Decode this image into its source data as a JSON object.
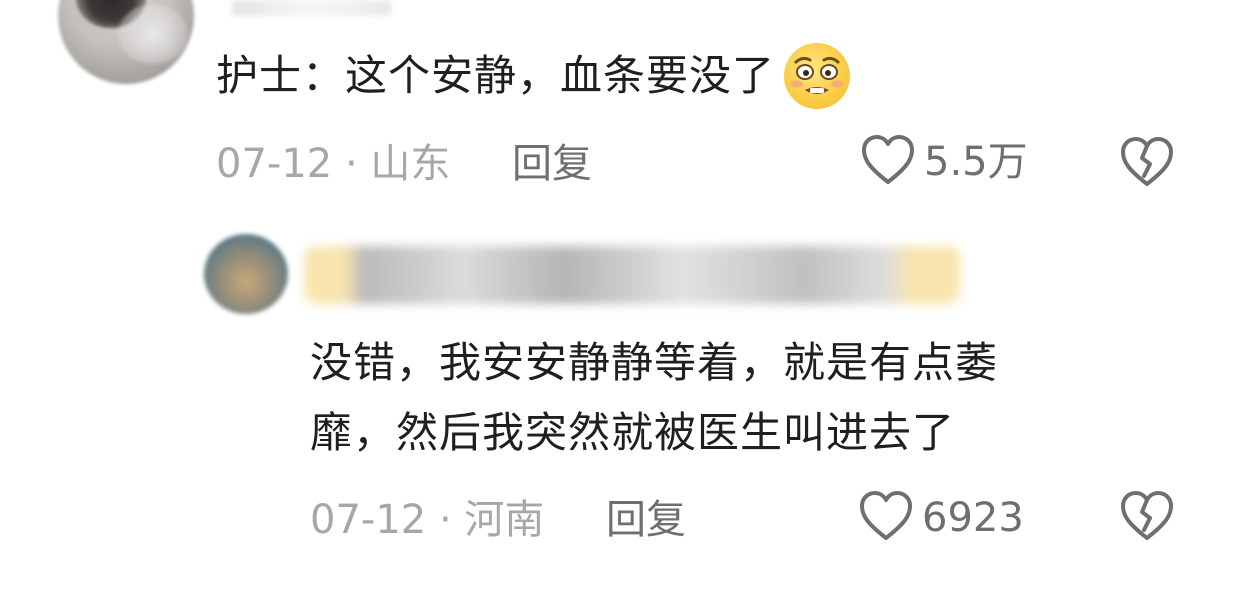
{
  "comment": {
    "text": "护士：这个安静，血条要没了",
    "emoji": "worried-face-emoji",
    "date_location": "07-12 · 山东",
    "reply_label": "回复",
    "like_count": "5.5万"
  },
  "reply": {
    "text_line1": "没错，我安安静静等着，就是有点萎",
    "text_line2": "靡，然后我突然就被医生叫进去了",
    "date_location": "07-12 · 河南",
    "reply_label": "回复",
    "like_count": "6923"
  },
  "colors": {
    "primary_text": "#1f1f1f",
    "meta_text": "#a7a7a7",
    "action_text": "#6f6f6f",
    "background": "#ffffff"
  },
  "icons": {
    "like": "heart-outline-icon",
    "dislike": "broken-heart-icon"
  }
}
